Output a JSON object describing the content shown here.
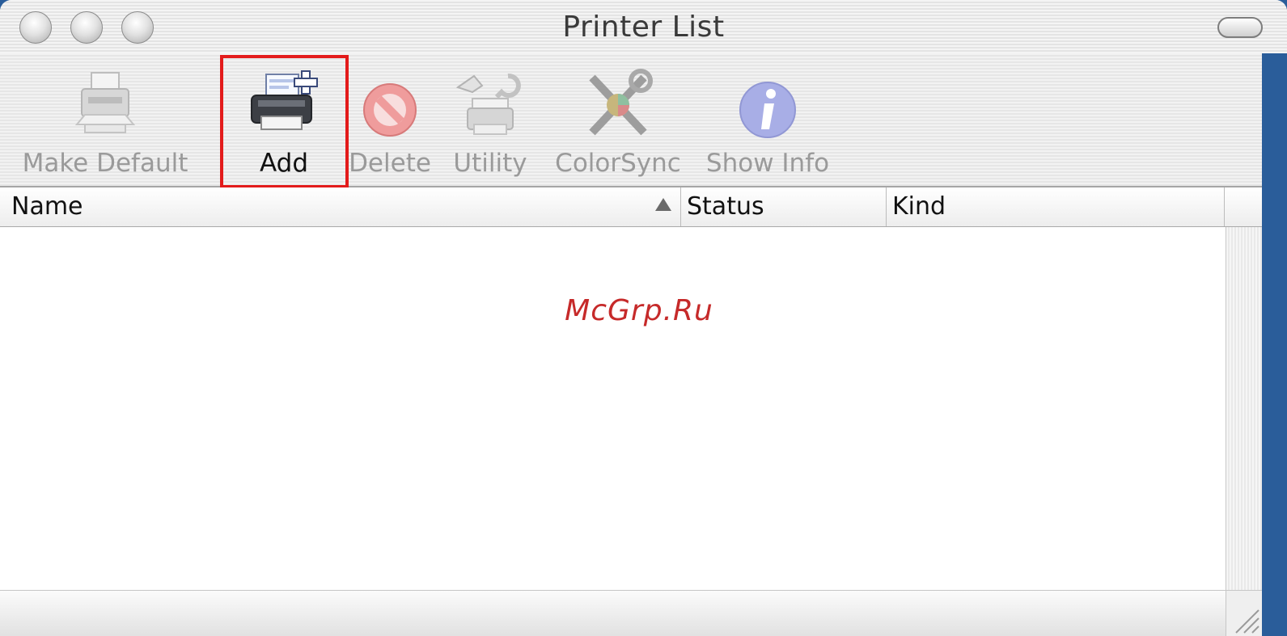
{
  "window": {
    "title": "Printer List"
  },
  "toolbar": {
    "items": [
      {
        "label": "Make Default",
        "icon": "make-default-printer-icon",
        "enabled": false
      },
      {
        "label": "Add",
        "icon": "add-printer-icon",
        "enabled": true
      },
      {
        "label": "Delete",
        "icon": "delete-icon",
        "enabled": false
      },
      {
        "label": "Utility",
        "icon": "utility-icon",
        "enabled": false
      },
      {
        "label": "ColorSync",
        "icon": "colorsync-icon",
        "enabled": false
      },
      {
        "label": "Show Info",
        "icon": "info-icon",
        "enabled": false
      }
    ]
  },
  "table": {
    "columns": [
      "Name",
      "Status",
      "Kind"
    ],
    "sort": {
      "column": "Name",
      "direction": "ascending"
    },
    "rows": []
  },
  "watermark": "McGrp.Ru",
  "colors": {
    "highlight": "#e31b1b",
    "watermark": "#c62a2a",
    "desktop": "#2a5d9a"
  }
}
